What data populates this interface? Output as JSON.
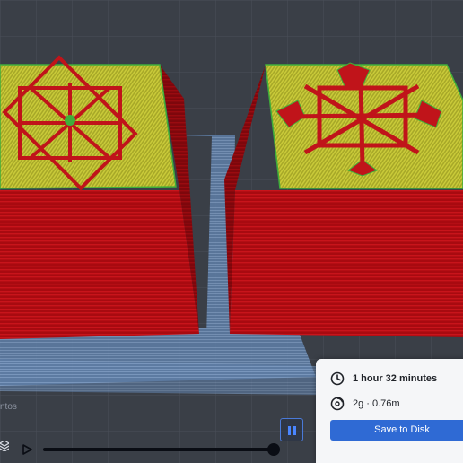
{
  "viewport": {
    "colors": {
      "background": "#3a3f47",
      "model_wall": "#b40b12",
      "model_wall_dark": "#8a080e",
      "top_infill": "#b3b32a",
      "outline_green": "#3fae3a",
      "build_plate_blue": "#6d8fb8"
    }
  },
  "print_summary": {
    "time_icon": "clock-icon",
    "time_text": "1 hour 32 minutes",
    "material_icon": "filament-spool-icon",
    "material_text": "2g · 0.76m",
    "save_label": "Save to Disk"
  },
  "preview_controls": {
    "clipped_label": "ntos",
    "pause_icon": "pause-icon",
    "play_icon": "play-icon",
    "layer_icon": "layers-icon",
    "progress": 1.0
  }
}
